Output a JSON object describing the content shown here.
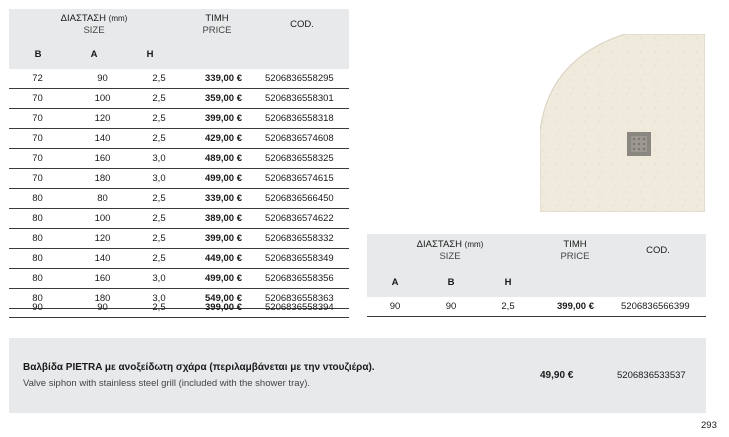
{
  "left_table": {
    "header": {
      "dimension_gr": "ΔΙΑΣΤΑΣΗ",
      "dimension_unit": "(mm)",
      "dimension_en": "SIZE",
      "price_gr": "ΤΙΜΗ",
      "price_en": "PRICE",
      "code": "COD.",
      "col_b": "B",
      "col_a": "A",
      "col_h": "H"
    },
    "rows": [
      {
        "b": "72",
        "a": "90",
        "h": "2,5",
        "price": "339,00 €",
        "code": "5206836558295"
      },
      {
        "b": "70",
        "a": "100",
        "h": "2,5",
        "price": "359,00 €",
        "code": "5206836558301"
      },
      {
        "b": "70",
        "a": "120",
        "h": "2,5",
        "price": "399,00 €",
        "code": "5206836558318"
      },
      {
        "b": "70",
        "a": "140",
        "h": "2,5",
        "price": "429,00 €",
        "code": "5206836574608"
      },
      {
        "b": "70",
        "a": "160",
        "h": "3,0",
        "price": "489,00 €",
        "code": "5206836558325"
      },
      {
        "b": "70",
        "a": "180",
        "h": "3,0",
        "price": "499,00 €",
        "code": "5206836574615"
      },
      {
        "b": "80",
        "a": "80",
        "h": "2,5",
        "price": "339,00 €",
        "code": "5206836566450"
      },
      {
        "b": "80",
        "a": "100",
        "h": "2,5",
        "price": "389,00 €",
        "code": "5206836574622"
      },
      {
        "b": "80",
        "a": "120",
        "h": "2,5",
        "price": "399,00 €",
        "code": "5206836558332"
      },
      {
        "b": "80",
        "a": "140",
        "h": "2,5",
        "price": "449,00 €",
        "code": "5206836558349"
      },
      {
        "b": "80",
        "a": "160",
        "h": "3,0",
        "price": "499,00 €",
        "code": "5206836558356"
      },
      {
        "b": "80",
        "a": "180",
        "h": "3,0",
        "price": "549,00 €",
        "code": "5206836558363"
      },
      {
        "b": "90",
        "a": "90",
        "h": "2,5",
        "price": "399,00 €",
        "code": "5206836558394"
      }
    ]
  },
  "right_table": {
    "header": {
      "dimension_gr": "ΔΙΑΣΤΑΣΗ",
      "dimension_unit": "(mm)",
      "dimension_en": "SIZE",
      "price_gr": "ΤΙΜΗ",
      "price_en": "PRICE",
      "code": "COD.",
      "col_a": "A",
      "col_b": "B",
      "col_h": "H"
    },
    "rows": [
      {
        "a": "90",
        "b": "90",
        "h": "2,5",
        "price": "399,00 €",
        "code": "5206836566399"
      }
    ]
  },
  "note": {
    "text_gr": "Βαλβίδα PIETRA με ανοξείδωτη σχάρα (περιλαμβάνεται με την ντουζιέρα).",
    "text_en": "Valve siphon with stainless steel grill (included with the shower tray).",
    "price": "49,90 €",
    "code": "5206836533537"
  },
  "page_number": "293",
  "colors": {
    "header_bg": "#e8e9ea",
    "tray": "#efeadb",
    "drain": "#8a8680"
  },
  "icons": [
    "shower-tray-image",
    "drain-grill-icon"
  ]
}
